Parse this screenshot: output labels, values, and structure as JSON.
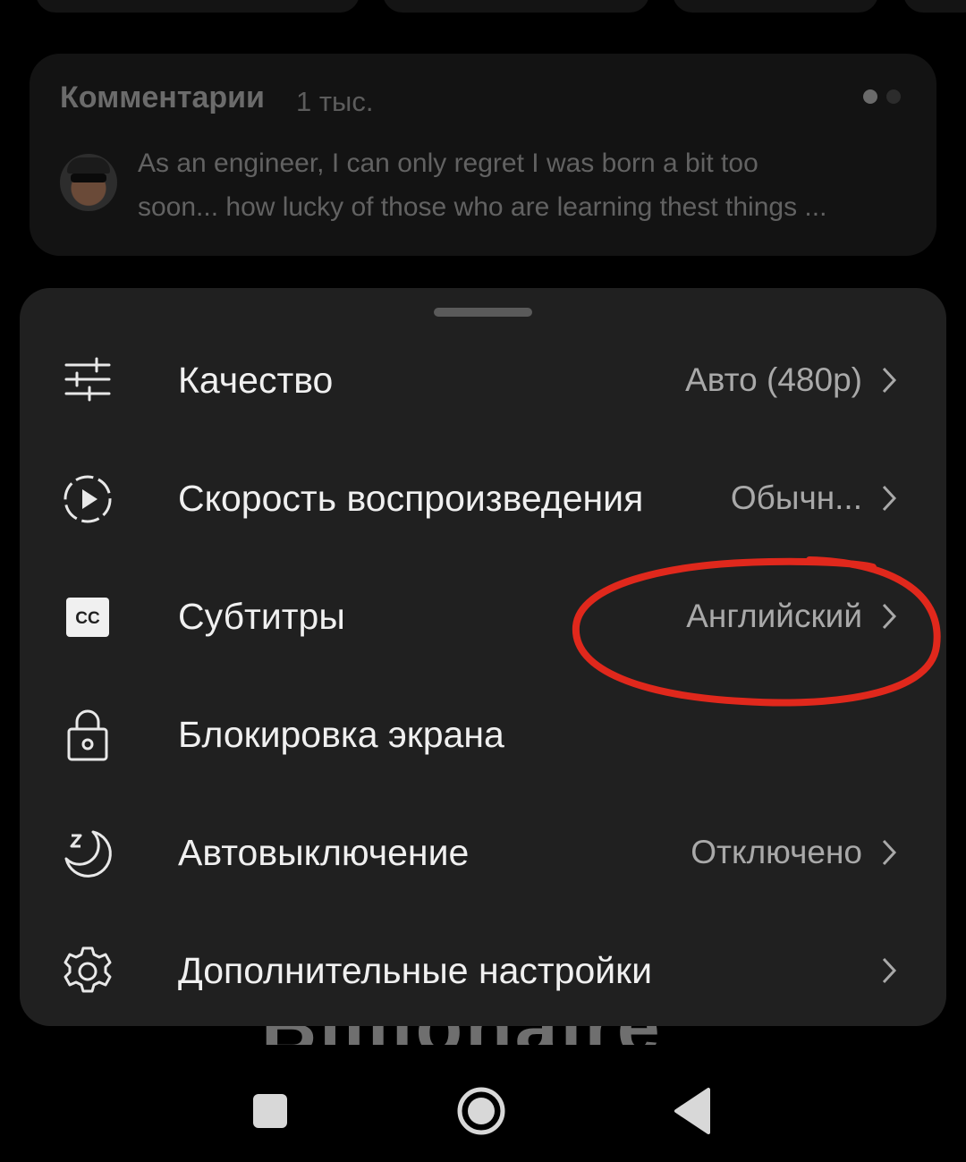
{
  "comments": {
    "title": "Комментарии",
    "count": "1 тыс.",
    "text_line1": "As an engineer, I can only regret I was born a bit too",
    "text_line2": "soon... how lucky of those who are learning thest things ..."
  },
  "background_title_fragment": "Billionaire",
  "settings_menu": {
    "items": [
      {
        "label": "Качество",
        "value": "Авто (480p)",
        "icon": "sliders-icon"
      },
      {
        "label": "Скорость воспроизведения",
        "value": "Обычн...",
        "icon": "play-speed-icon"
      },
      {
        "label": "Субтитры",
        "value": "Английский",
        "icon": "cc-icon"
      },
      {
        "label": "Блокировка экрана",
        "value": "",
        "icon": "lock-icon"
      },
      {
        "label": "Автовыключение",
        "value": "Отключено",
        "icon": "sleep-timer-icon"
      },
      {
        "label": "Дополнительные настройки",
        "value": "",
        "icon": "gear-icon"
      }
    ]
  },
  "colors": {
    "sheet_background": "#202020",
    "annotation_circle": "#e0281c",
    "dot_active": "#6a6a6a",
    "dot_inactive": "#2c2c2c"
  },
  "navbar": {
    "buttons": [
      "recent-apps-icon",
      "home-icon",
      "back-icon"
    ]
  }
}
